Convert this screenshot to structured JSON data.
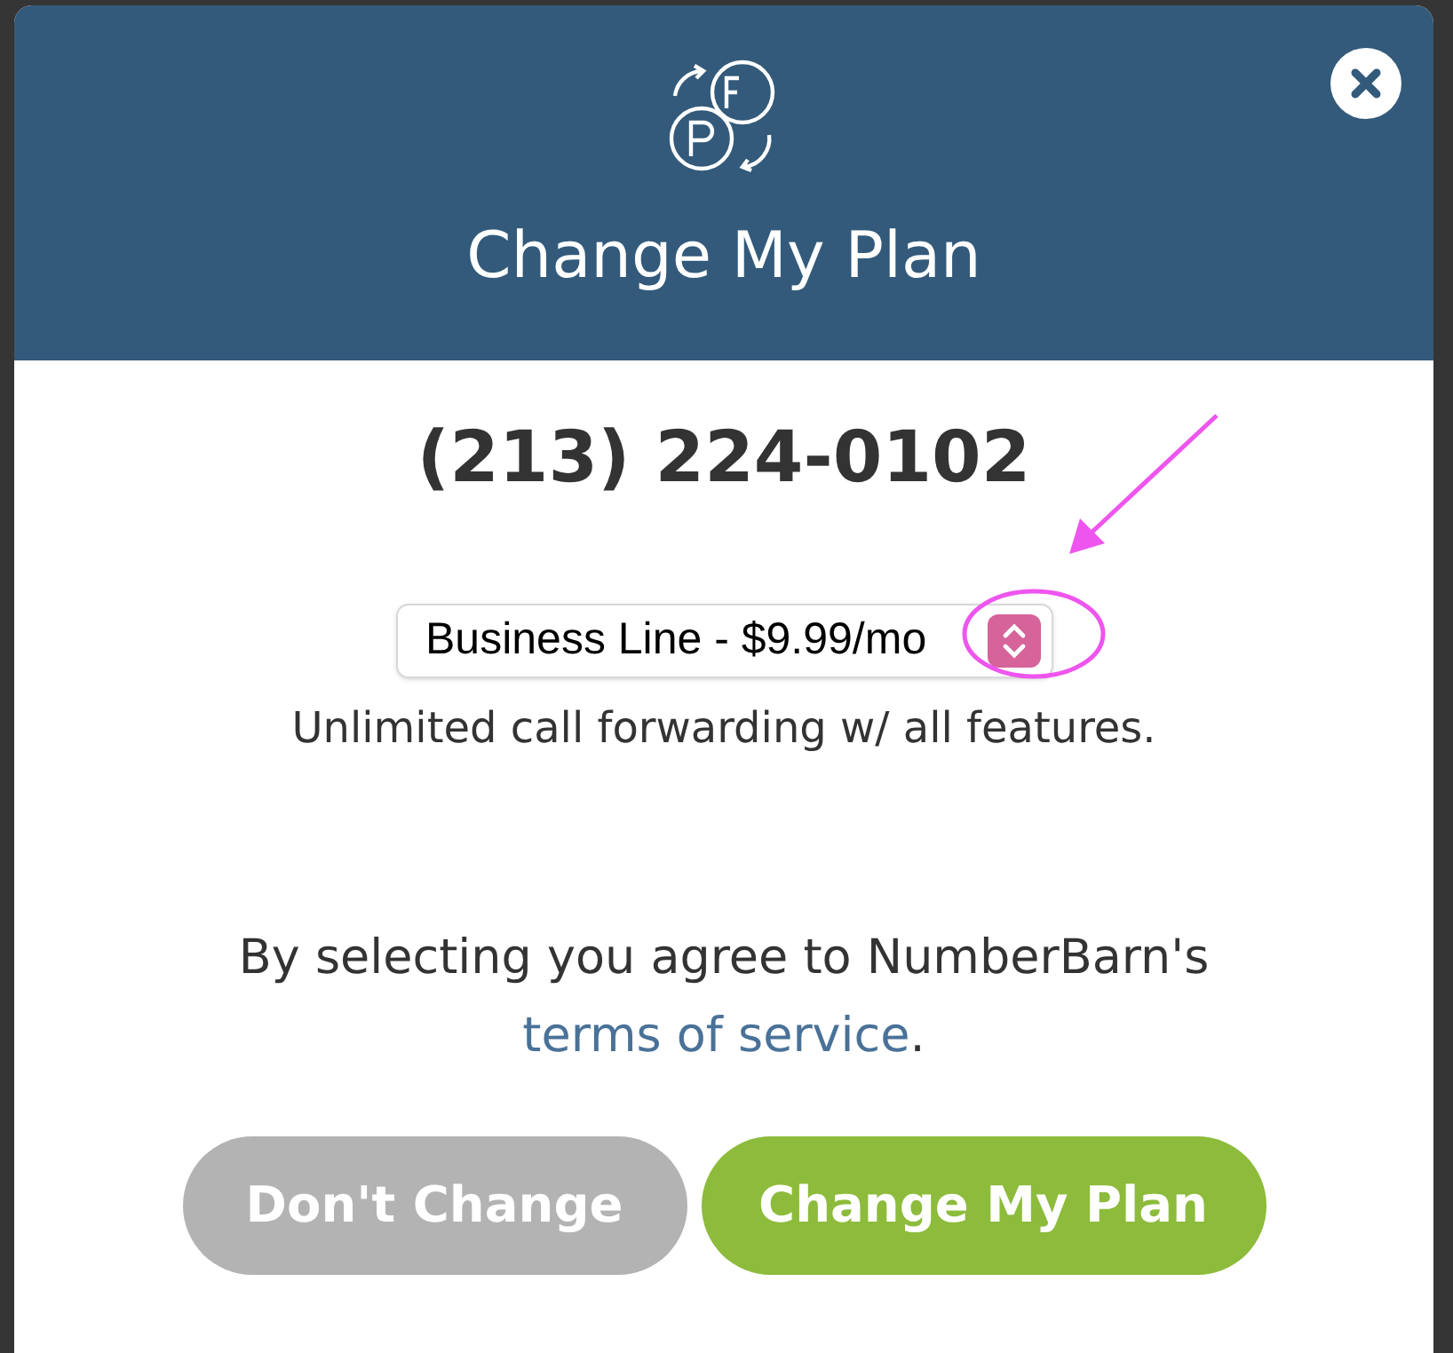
{
  "dialog": {
    "title": "Change My Plan"
  },
  "phone_number": "(213) 224-0102",
  "plan_select": {
    "value": "Business Line - $9.99/mo"
  },
  "plan_description": "Unlimited call forwarding w/ all features.",
  "agreement": {
    "text": "By selecting you agree to NumberBarn's ",
    "link": "terms of service",
    "suffix": "."
  },
  "buttons": [
    {
      "label": "Don't Change",
      "kind": "secondary"
    },
    {
      "label": "Change My Plan",
      "kind": "primary"
    }
  ]
}
